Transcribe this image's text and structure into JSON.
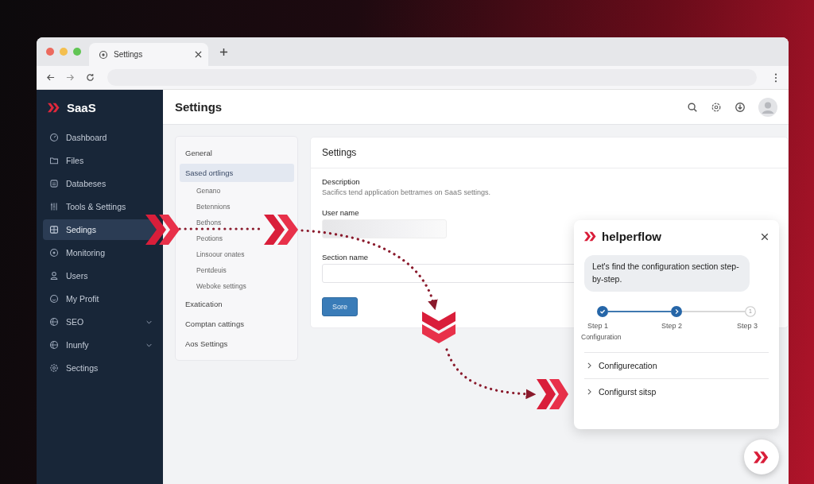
{
  "browser": {
    "tab": {
      "title": "Settings"
    }
  },
  "sidebar": {
    "brand": "SaaS",
    "items": [
      {
        "label": "Dashboard",
        "kind": "dashboard",
        "selected": false,
        "expandable": false
      },
      {
        "label": "Files",
        "kind": "folder",
        "selected": false,
        "expandable": false
      },
      {
        "label": "Databeses",
        "kind": "database",
        "selected": false,
        "expandable": false
      },
      {
        "label": "Tools & Settings",
        "kind": "tools",
        "selected": false,
        "expandable": false
      },
      {
        "label": "Sedings",
        "kind": "grid",
        "selected": true,
        "expandable": false
      },
      {
        "label": "Monitoring",
        "kind": "monitor",
        "selected": false,
        "expandable": false
      },
      {
        "label": "Users",
        "kind": "user",
        "selected": false,
        "expandable": false
      },
      {
        "label": "My Profit",
        "kind": "smile",
        "selected": false,
        "expandable": false
      },
      {
        "label": "SEO",
        "kind": "globe",
        "selected": false,
        "expandable": true
      },
      {
        "label": "Inunfy",
        "kind": "globe",
        "selected": false,
        "expandable": true
      },
      {
        "label": "Sectings",
        "kind": "gear",
        "selected": false,
        "expandable": false
      }
    ]
  },
  "header": {
    "title": "Settings"
  },
  "subnav": [
    {
      "label": "General",
      "selected": false
    },
    {
      "label": "Sased ortlings",
      "selected": true,
      "children": [
        {
          "label": "Genano"
        },
        {
          "label": "Betennions"
        },
        {
          "label": "Bethons"
        },
        {
          "label": "Peotions"
        },
        {
          "label": "Linsoour onates"
        },
        {
          "label": "Pentdeuis"
        },
        {
          "label": "Weboke settings"
        }
      ]
    },
    {
      "label": "Exatication",
      "selected": false
    },
    {
      "label": "Comptan cattings",
      "selected": false
    },
    {
      "label": "Aos Settings",
      "selected": false
    }
  ],
  "card": {
    "title": "Settings",
    "description_label": "Description",
    "description": "Sacifics tend application bettrames on SaaS settings.",
    "fields": [
      {
        "label": "User name",
        "kind": "filled"
      },
      {
        "label": "Section name",
        "kind": "empty"
      }
    ],
    "button": "Sore"
  },
  "helper": {
    "brand": "helperflow",
    "message": "Let's find the configuration section step-by-step.",
    "steps": [
      {
        "label": "Step 1",
        "kind": "done",
        "caption": "Configuration"
      },
      {
        "label": "Step 2",
        "kind": "current"
      },
      {
        "label": "Step 3",
        "kind": "pending",
        "number": "1"
      }
    ],
    "links": [
      {
        "label": "Configurecation"
      },
      {
        "label": "Configurst sitsp"
      }
    ]
  }
}
